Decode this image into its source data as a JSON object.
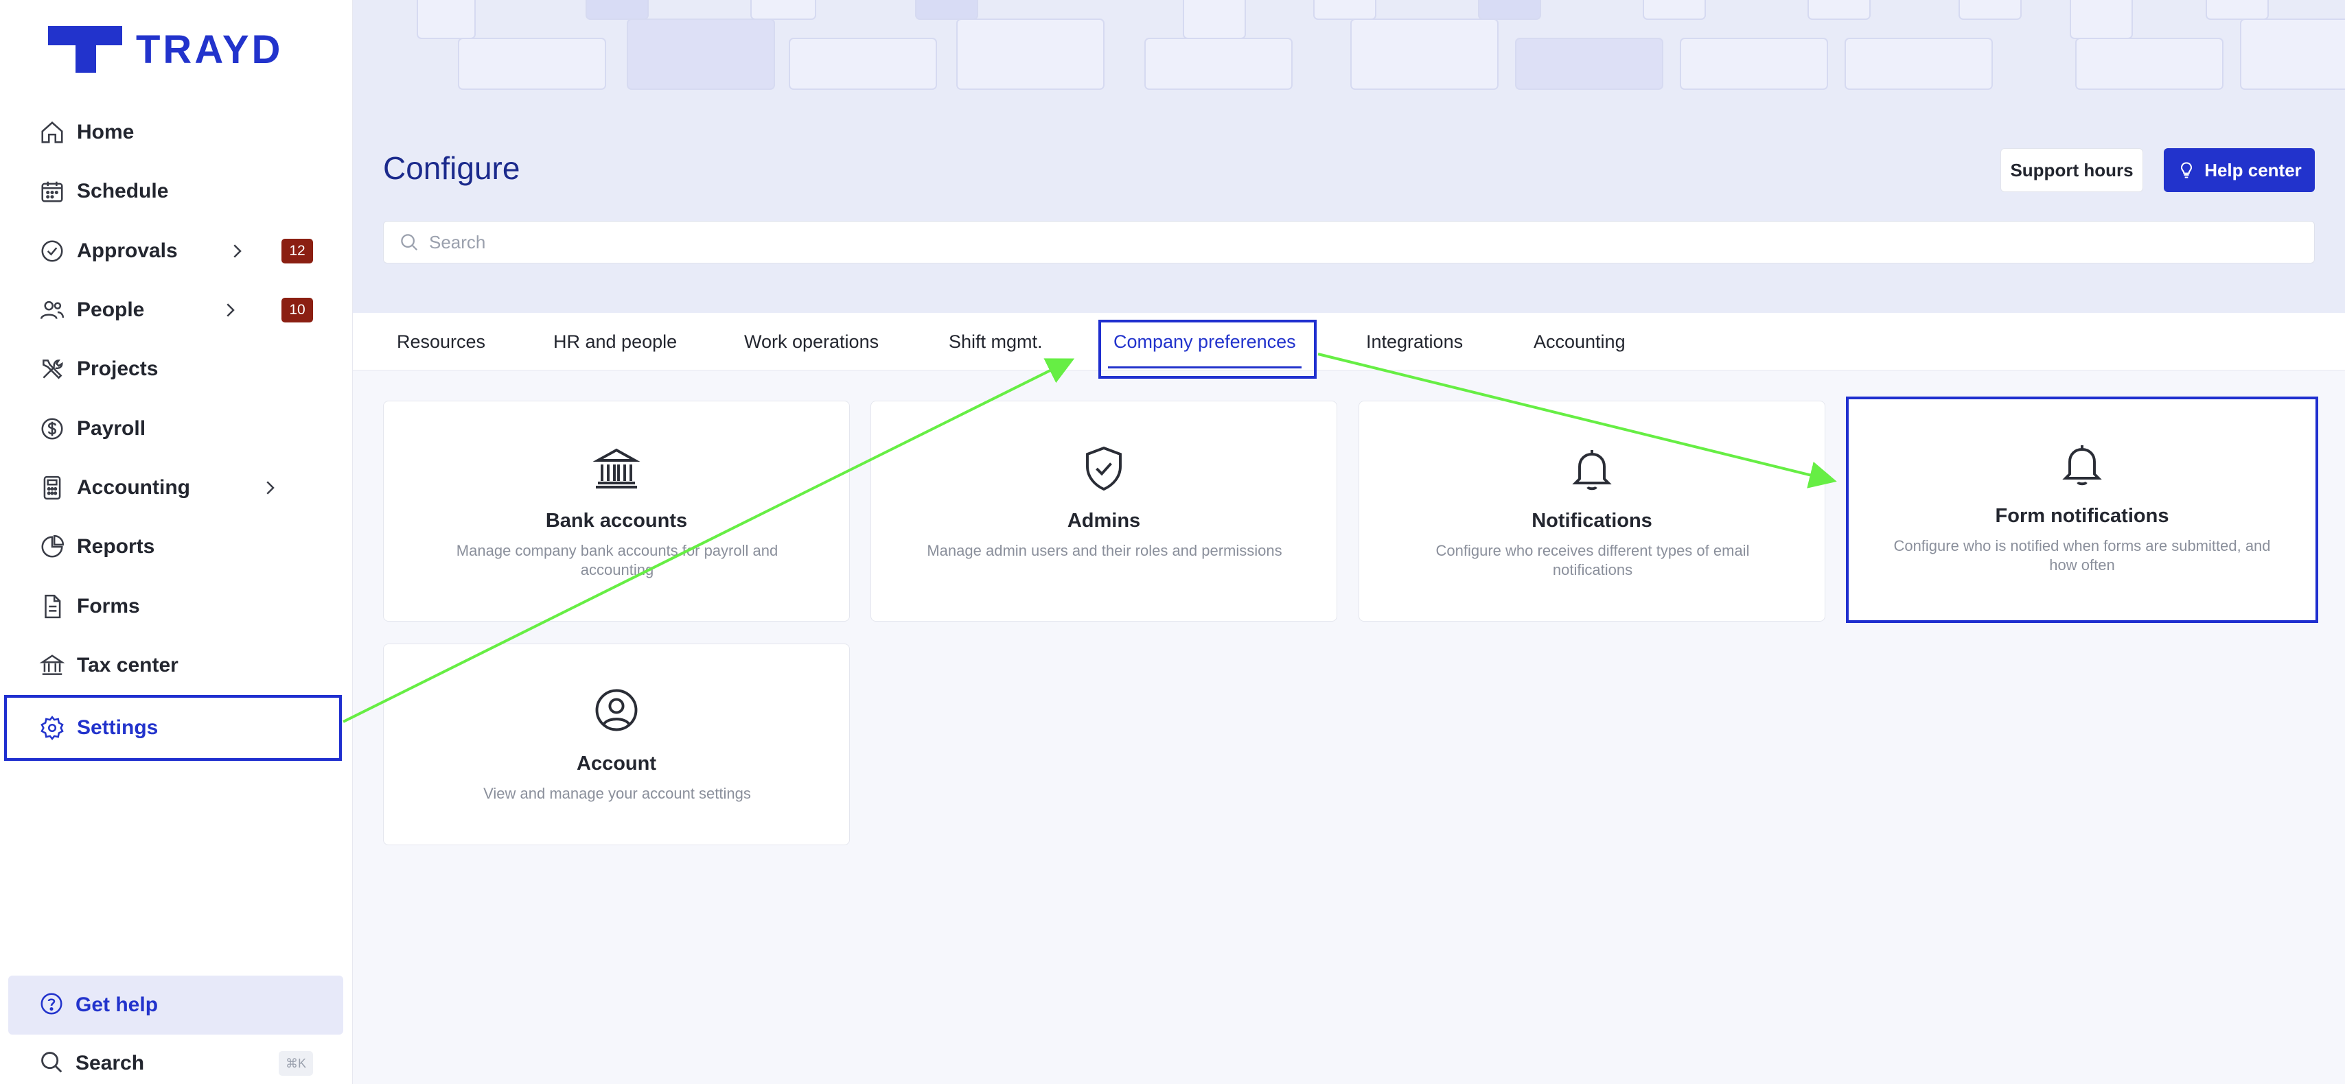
{
  "app": {
    "logo_text": "TRAYD",
    "brand_color": "#2233cc"
  },
  "sidebar": {
    "items": [
      {
        "label": "Home",
        "icon": "home-icon"
      },
      {
        "label": "Schedule",
        "icon": "calendar-icon"
      },
      {
        "label": "Approvals",
        "icon": "check-circle-icon",
        "badge": "12",
        "has_chevron": true
      },
      {
        "label": "People",
        "icon": "users-icon",
        "badge": "10",
        "has_chevron": true
      },
      {
        "label": "Projects",
        "icon": "tools-icon"
      },
      {
        "label": "Payroll",
        "icon": "dollar-icon"
      },
      {
        "label": "Accounting",
        "icon": "calculator-icon",
        "has_chevron": true
      },
      {
        "label": "Reports",
        "icon": "pie-chart-icon"
      },
      {
        "label": "Forms",
        "icon": "document-icon"
      },
      {
        "label": "Tax center",
        "icon": "bank-icon"
      },
      {
        "label": "Settings",
        "icon": "gear-icon",
        "active": true
      }
    ],
    "get_help": "Get help",
    "search": "Search",
    "search_shortcut": "⌘K"
  },
  "header": {
    "title": "Configure",
    "support_hours": "Support hours",
    "help_center": "Help center",
    "search_placeholder": "Search"
  },
  "tabs": [
    {
      "label": "Resources"
    },
    {
      "label": "HR and people"
    },
    {
      "label": "Work operations"
    },
    {
      "label": "Shift mgmt."
    },
    {
      "label": "Company preferences",
      "active": true
    },
    {
      "label": "Integrations"
    },
    {
      "label": "Accounting"
    }
  ],
  "cards": [
    {
      "title": "Bank accounts",
      "description": "Manage company bank accounts for payroll and accounting",
      "icon": "bank-icon"
    },
    {
      "title": "Admins",
      "description": "Manage admin users and their roles and permissions",
      "icon": "shield-check-icon"
    },
    {
      "title": "Notifications",
      "description": "Configure who receives different types of email notifications",
      "icon": "bell-icon"
    },
    {
      "title": "Form notifications",
      "description": "Configure who is notified when forms are submitted, and how often",
      "icon": "bell-icon",
      "highlighted": true
    },
    {
      "title": "Account",
      "description": "View and manage your account settings",
      "icon": "user-circle-icon"
    }
  ],
  "annotation_colors": {
    "box": "#1f2fcf",
    "arrow": "#66ee44"
  }
}
